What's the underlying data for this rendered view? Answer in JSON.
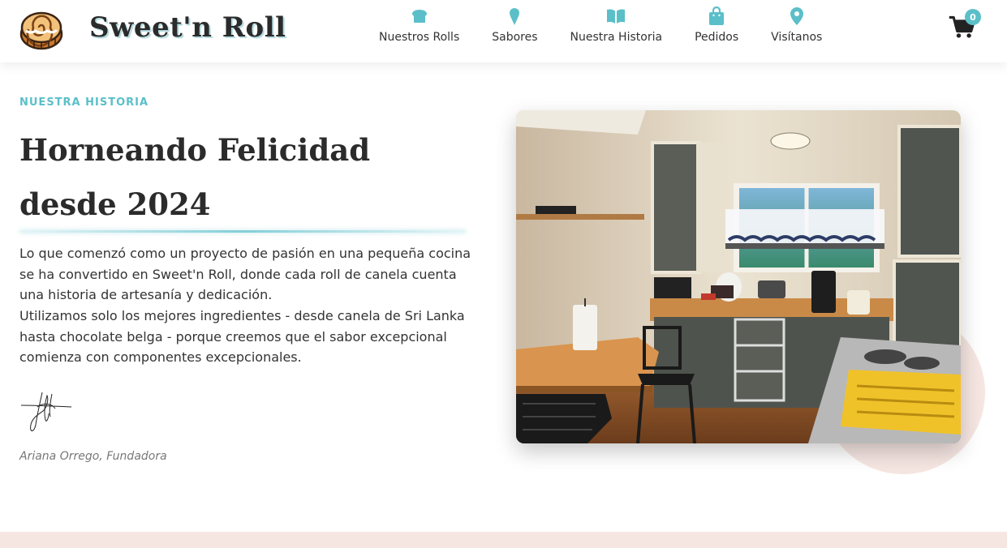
{
  "brand": {
    "name": "Sweet'n Roll",
    "logo_icon": "cinnamon-roll-icon"
  },
  "nav": {
    "items": [
      {
        "label": "Nuestros Rolls",
        "icon": "bread-icon"
      },
      {
        "label": "Sabores",
        "icon": "ice-cream-icon"
      },
      {
        "label": "Nuestra Historia",
        "icon": "book-icon"
      },
      {
        "label": "Pedidos",
        "icon": "shopping-bag-icon"
      },
      {
        "label": "Visítanos",
        "icon": "map-pin-icon"
      }
    ]
  },
  "cart": {
    "count": "0",
    "icon": "cart-icon"
  },
  "story": {
    "eyebrow": "NUESTRA HISTORIA",
    "title": "Horneando Felicidad desde 2024",
    "paragraph1": "Lo que comenzó como un proyecto de pasión en una pequeña cocina se ha convertido en Sweet'n Roll, donde cada roll de canela cuenta una historia de artesanía y dedicación.",
    "paragraph2": "Utilizamos solo los mejores ingredientes - desde canela de Sri Lanka hasta chocolate belga - porque creemos que el sabor excepcional comienza con componentes excepcionales.",
    "founder": "Ariana Orrego, Fundadora"
  },
  "colors": {
    "accent": "#5bbfc9",
    "text": "#2b2b2b",
    "blush": "#f6e6e2"
  }
}
